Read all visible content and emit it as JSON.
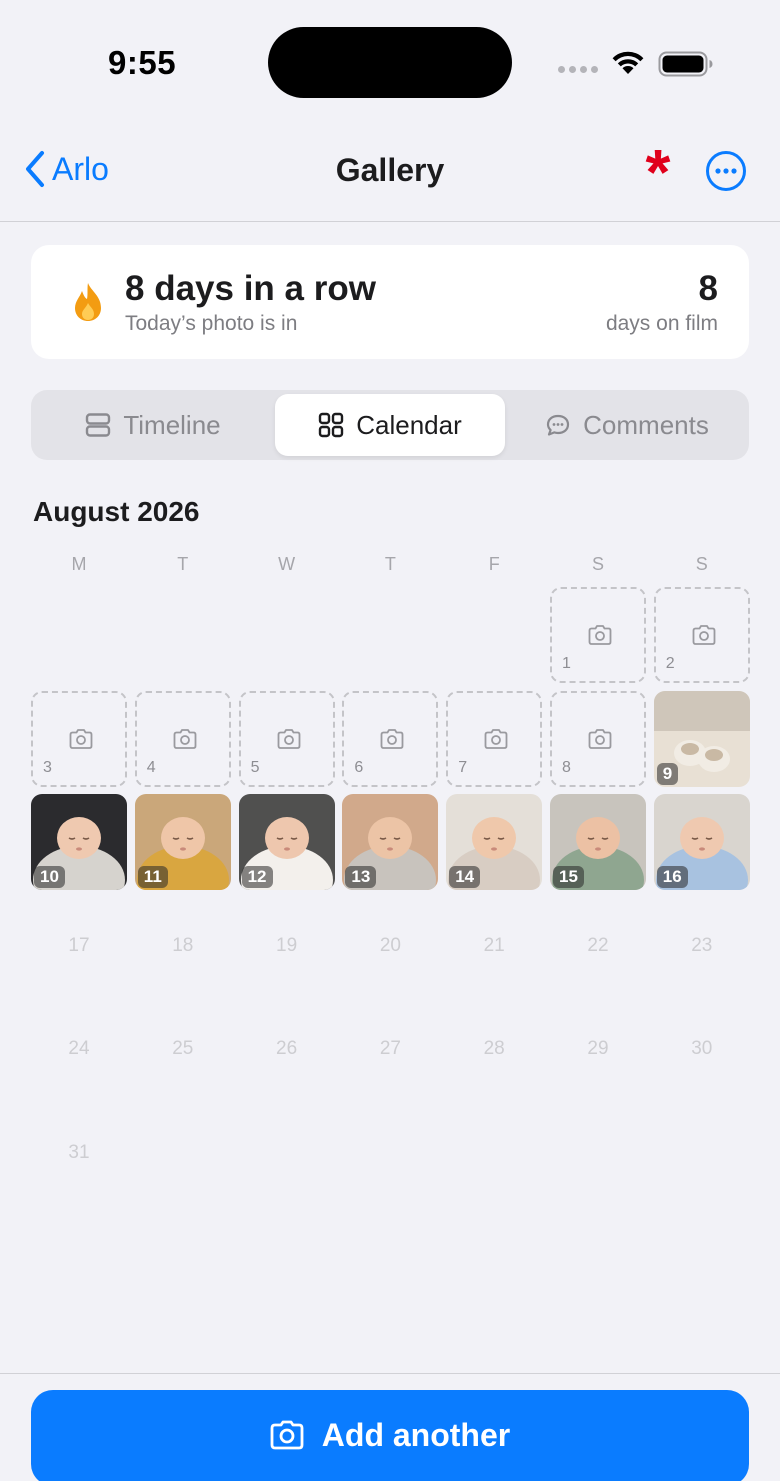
{
  "status_bar": {
    "time": "9:55"
  },
  "nav": {
    "back_label": "Arlo",
    "title": "Gallery",
    "asterisk": "*"
  },
  "streak": {
    "title": "8 days in a row",
    "subtitle": "Today’s photo is in",
    "count": "8",
    "count_label": "days on film"
  },
  "tabs": [
    {
      "label": "Timeline",
      "icon": "timeline-icon",
      "active": false
    },
    {
      "label": "Calendar",
      "icon": "grid-icon",
      "active": true
    },
    {
      "label": "Comments",
      "icon": "comment-icon",
      "active": false
    }
  ],
  "calendar": {
    "month": "August 2026",
    "weekdays": [
      "M",
      "T",
      "W",
      "T",
      "F",
      "S",
      "S"
    ],
    "first_weekday_index": 5,
    "empty_days": [
      "1",
      "2",
      "3",
      "4",
      "5",
      "6",
      "7",
      "8"
    ],
    "photo_days": [
      "9",
      "10",
      "11",
      "12",
      "13",
      "14",
      "15",
      "16"
    ],
    "future_days": [
      "17",
      "18",
      "19",
      "20",
      "21",
      "22",
      "23",
      "24",
      "25",
      "26",
      "27",
      "28",
      "29",
      "30",
      "31"
    ]
  },
  "bottom": {
    "add_label": "Add another"
  },
  "colors": {
    "accent": "#0a7cff",
    "asterisk": "#e0001b",
    "background": "#f2f2f7"
  }
}
